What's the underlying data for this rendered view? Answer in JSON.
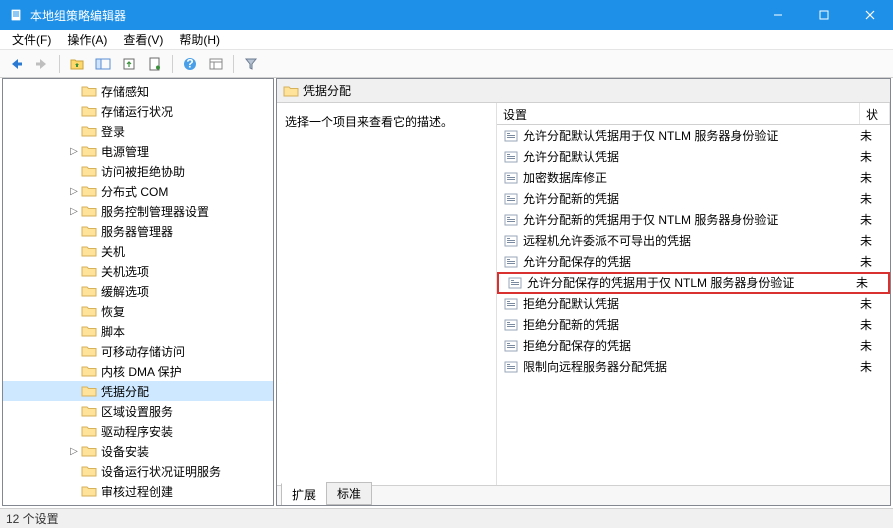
{
  "window": {
    "title": "本地组策略编辑器"
  },
  "menu": {
    "file": "文件(F)",
    "action": "操作(A)",
    "view": "查看(V)",
    "help": "帮助(H)"
  },
  "tree": {
    "items": [
      {
        "label": "存储感知",
        "indent": 4,
        "twisty": ""
      },
      {
        "label": "存储运行状况",
        "indent": 4,
        "twisty": ""
      },
      {
        "label": "登录",
        "indent": 4,
        "twisty": ""
      },
      {
        "label": "电源管理",
        "indent": 4,
        "twisty": "▷"
      },
      {
        "label": "访问被拒绝协助",
        "indent": 4,
        "twisty": ""
      },
      {
        "label": "分布式 COM",
        "indent": 4,
        "twisty": "▷"
      },
      {
        "label": "服务控制管理器设置",
        "indent": 4,
        "twisty": "▷"
      },
      {
        "label": "服务器管理器",
        "indent": 4,
        "twisty": ""
      },
      {
        "label": "关机",
        "indent": 4,
        "twisty": ""
      },
      {
        "label": "关机选项",
        "indent": 4,
        "twisty": ""
      },
      {
        "label": "缓解选项",
        "indent": 4,
        "twisty": ""
      },
      {
        "label": "恢复",
        "indent": 4,
        "twisty": ""
      },
      {
        "label": "脚本",
        "indent": 4,
        "twisty": ""
      },
      {
        "label": "可移动存储访问",
        "indent": 4,
        "twisty": ""
      },
      {
        "label": "内核 DMA 保护",
        "indent": 4,
        "twisty": ""
      },
      {
        "label": "凭据分配",
        "indent": 4,
        "twisty": "",
        "selected": true
      },
      {
        "label": "区域设置服务",
        "indent": 4,
        "twisty": ""
      },
      {
        "label": "驱动程序安装",
        "indent": 4,
        "twisty": ""
      },
      {
        "label": "设备安装",
        "indent": 4,
        "twisty": "▷"
      },
      {
        "label": "设备运行状况证明服务",
        "indent": 4,
        "twisty": ""
      },
      {
        "label": "审核过程创建",
        "indent": 4,
        "twisty": ""
      }
    ]
  },
  "right": {
    "header_title": "凭据分配",
    "description": "选择一个项目来查看它的描述。",
    "columns": {
      "setting": "设置",
      "state": "状"
    },
    "rows": [
      {
        "label": "允许分配默认凭据用于仅 NTLM 服务器身份验证",
        "state": "未",
        "highlighted": false
      },
      {
        "label": "允许分配默认凭据",
        "state": "未",
        "highlighted": false
      },
      {
        "label": "加密数据库修正",
        "state": "未",
        "highlighted": false
      },
      {
        "label": "允许分配新的凭据",
        "state": "未",
        "highlighted": false
      },
      {
        "label": "允许分配新的凭据用于仅 NTLM 服务器身份验证",
        "state": "未",
        "highlighted": false
      },
      {
        "label": "远程机允许委派不可导出的凭据",
        "state": "未",
        "highlighted": false
      },
      {
        "label": "允许分配保存的凭据",
        "state": "未",
        "highlighted": false
      },
      {
        "label": "允许分配保存的凭据用于仅 NTLM 服务器身份验证",
        "state": "未",
        "highlighted": true
      },
      {
        "label": "拒绝分配默认凭据",
        "state": "未",
        "highlighted": false
      },
      {
        "label": "拒绝分配新的凭据",
        "state": "未",
        "highlighted": false
      },
      {
        "label": "拒绝分配保存的凭据",
        "state": "未",
        "highlighted": false
      },
      {
        "label": "限制向远程服务器分配凭据",
        "state": "未",
        "highlighted": false
      }
    ],
    "tabs": {
      "extended": "扩展",
      "standard": "标准"
    }
  },
  "statusbar": {
    "text": "12 个设置"
  }
}
